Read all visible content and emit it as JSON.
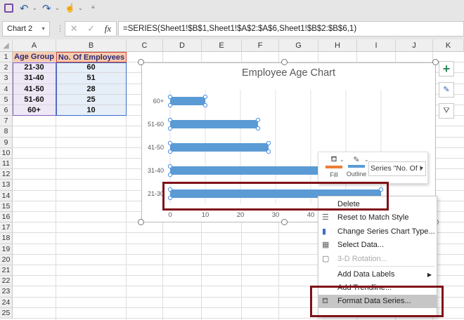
{
  "qat": {
    "icons": [
      "save-icon",
      "undo-icon",
      "redo-icon",
      "touch-mode-icon",
      "customize-icon"
    ]
  },
  "formula_bar": {
    "name_box": "Chart 2",
    "cancel": "✕",
    "enter": "✓",
    "fx": "fx",
    "formula": "=SERIES(Sheet1!$B$1,Sheet1!$A$2:$A$6,Sheet1!$B$2:$B$6,1)"
  },
  "columns": [
    "A",
    "B",
    "C",
    "D",
    "E",
    "F",
    "G",
    "H",
    "I",
    "J",
    "K"
  ],
  "rows": [
    "1",
    "2",
    "3",
    "4",
    "5",
    "6",
    "7",
    "8",
    "9",
    "10",
    "11",
    "12",
    "13",
    "14",
    "15",
    "16",
    "17",
    "18",
    "19",
    "20",
    "21",
    "22",
    "23",
    "24",
    "25"
  ],
  "table": {
    "headers": [
      "Age Group",
      "No. Of Employees"
    ],
    "rows": [
      [
        "21-30",
        "60"
      ],
      [
        "31-40",
        "51"
      ],
      [
        "41-50",
        "28"
      ],
      [
        "51-60",
        "25"
      ],
      [
        "60+",
        "10"
      ]
    ]
  },
  "chart_data": {
    "type": "bar",
    "orientation": "horizontal",
    "title": "Employee Age Chart",
    "categories": [
      "21-30",
      "31-40",
      "41-50",
      "51-60",
      "60+"
    ],
    "values": [
      60,
      51,
      28,
      25,
      10
    ],
    "xlim": [
      0,
      60
    ],
    "x_ticks": [
      "0",
      "10",
      "20",
      "30",
      "40"
    ],
    "grid": true,
    "color": "#5b9bd5"
  },
  "chart_side_buttons": [
    "chart-elements-icon",
    "chart-styles-icon",
    "chart-filters-icon"
  ],
  "mini_toolbar": {
    "fill": "Fill",
    "outline": "Outline",
    "series_select": "Series \"No. Of I",
    "fill_color": "#ed7d31",
    "outline_color": "#5b9bd5"
  },
  "context_menu": [
    {
      "label": "Delete",
      "icon": "",
      "enabled": true
    },
    {
      "label": "Reset to Match Style",
      "icon": "reset-style-icon",
      "enabled": true
    },
    {
      "label": "Change Series Chart Type...",
      "icon": "chart-type-icon",
      "enabled": true
    },
    {
      "label": "Select Data...",
      "icon": "select-data-icon",
      "enabled": true
    },
    {
      "label": "3-D Rotation...",
      "icon": "3d-rotation-icon",
      "enabled": false
    },
    {
      "label": "Add Data Labels",
      "icon": "",
      "enabled": true,
      "submenu": true
    },
    {
      "label": "Add Trendline...",
      "icon": "",
      "enabled": true
    },
    {
      "label": "Format Data Series...",
      "icon": "format-series-icon",
      "enabled": true,
      "highlighted": true
    }
  ],
  "highlight_color": "#7f1019"
}
